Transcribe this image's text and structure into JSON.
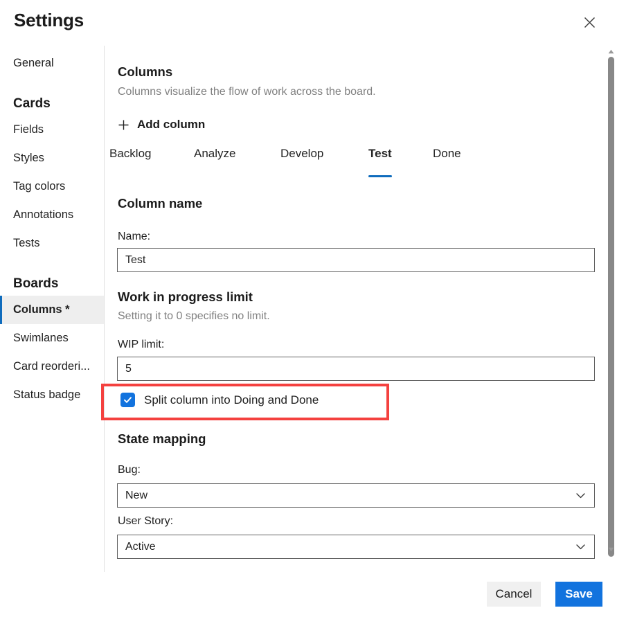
{
  "header": {
    "title": "Settings",
    "close_icon": "close-icon"
  },
  "sidebar": {
    "items": [
      {
        "label": "General",
        "type": "item",
        "selected": false
      },
      {
        "label": "Cards",
        "type": "group"
      },
      {
        "label": "Fields",
        "type": "item",
        "selected": false
      },
      {
        "label": "Styles",
        "type": "item",
        "selected": false
      },
      {
        "label": "Tag colors",
        "type": "item",
        "selected": false
      },
      {
        "label": "Annotations",
        "type": "item",
        "selected": false
      },
      {
        "label": "Tests",
        "type": "item",
        "selected": false
      },
      {
        "label": "Boards",
        "type": "group"
      },
      {
        "label": "Columns *",
        "type": "item",
        "selected": true
      },
      {
        "label": "Swimlanes",
        "type": "item",
        "selected": false
      },
      {
        "label": "Card reorderi...",
        "type": "item",
        "selected": false
      },
      {
        "label": "Status badge",
        "type": "item",
        "selected": false
      }
    ]
  },
  "main": {
    "section_title": "Columns",
    "section_desc": "Columns visualize the flow of work across the board.",
    "add_column_label": "Add column",
    "add_column_icon": "plus-icon",
    "tabs": [
      {
        "label": "Backlog",
        "active": false
      },
      {
        "label": "Analyze",
        "active": false
      },
      {
        "label": "Develop",
        "active": false
      },
      {
        "label": "Test",
        "active": true
      },
      {
        "label": "Done",
        "active": false
      }
    ],
    "column_name": {
      "heading": "Column name",
      "name_label": "Name:",
      "name_value": "Test",
      "name_placeholder": "Enter column name"
    },
    "wip": {
      "heading": "Work in progress limit",
      "description": "Setting it to 0 specifies no limit.",
      "limit_label": "WIP limit:",
      "limit_value": "5",
      "limit_placeholder": "0"
    },
    "split_checkbox": {
      "label": "Split column into Doing and Done",
      "checked": true
    },
    "state_mapping": {
      "heading": "State mapping",
      "bug_label": "Bug:",
      "bug_value": "New",
      "user_story_label": "User Story:",
      "user_story_value": "Active",
      "chevron_icon": "chevron-down-icon"
    }
  },
  "footer": {
    "cancel_label": "Cancel",
    "save_label": "Save"
  },
  "scrollbar": {
    "up_icon": "caret-up-icon",
    "down_icon": "caret-down-icon"
  },
  "colors": {
    "accent": "#0f6cbd",
    "primary_button": "#1273de",
    "highlight": "#f4413f",
    "selected_bg": "#eeeeee"
  }
}
